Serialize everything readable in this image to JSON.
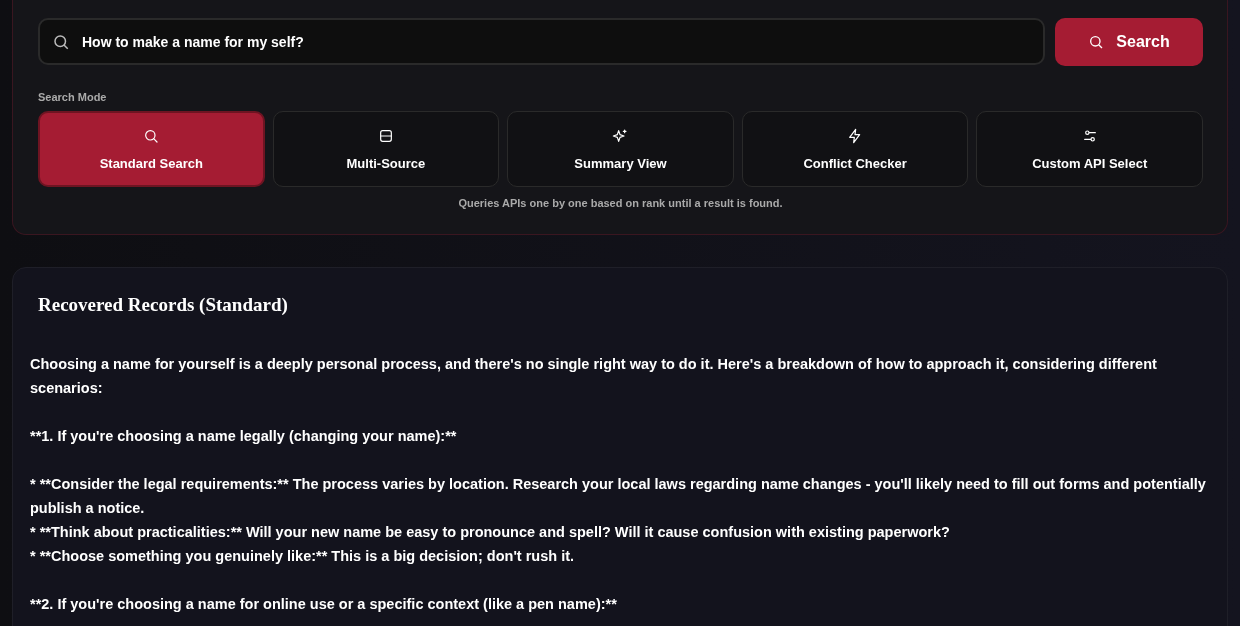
{
  "search": {
    "value": "How to make a name for my self?",
    "button": "Search"
  },
  "search_mode": {
    "label": "Search Mode",
    "modes": [
      {
        "label": "Standard Search",
        "kind": "search",
        "selected": true
      },
      {
        "label": "Multi-Source",
        "kind": "layout",
        "selected": false
      },
      {
        "label": "Summary View",
        "kind": "sparkles",
        "selected": false
      },
      {
        "label": "Conflict Checker",
        "kind": "bolt",
        "selected": false
      },
      {
        "label": "Custom API Select",
        "kind": "sliders",
        "selected": false
      }
    ],
    "hint": "Queries APIs one by one based on rank until a result is found."
  },
  "results": {
    "title": "Recovered Records (Standard)",
    "paragraphs": [
      [
        "Choosing a name for yourself is a deeply personal process, and there's no single right way to do it.  Here's a breakdown of how to approach it, considering different scenarios:"
      ],
      [
        "**1.  If you're choosing a name legally (changing your name):**"
      ],
      [
        "* **Consider the legal requirements:**  The process varies by location. Research your local laws regarding name changes - you'll likely need to fill out forms and potentially publish a notice.",
        "* **Think about practicalities:**  Will your new name be easy to pronounce and spell?  Will it cause confusion with existing paperwork?",
        "* **Choose something you genuinely like:** This is a big decision; don't rush it."
      ],
      [
        "**2. If you're choosing a name for online use or a specific context (like a pen name):**"
      ]
    ]
  }
}
